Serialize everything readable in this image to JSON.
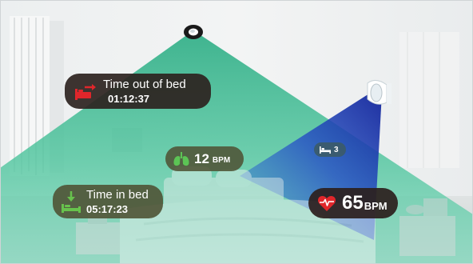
{
  "time_out_of_bed": {
    "label": "Time out of bed",
    "value": "01:12:37"
  },
  "time_in_bed": {
    "label": "Time in bed",
    "value": "05:17:23"
  },
  "respiration": {
    "value": "12",
    "unit": "BPM"
  },
  "heart_rate": {
    "value": "65",
    "unit": "BPM"
  },
  "bed_occupancy": {
    "value": "3"
  },
  "colors": {
    "green_beam": "#3dbf93",
    "blue_beam": "#1f3fb8",
    "pill_dark": "#2c2320",
    "pill_olive": "#4f5335",
    "pill_slate": "#3c5a63",
    "alert_red": "#e0262b",
    "lung_green": "#5cc455",
    "bed_green": "#67c24d"
  },
  "icons": {
    "time_out_of_bed": "bed-exit-icon",
    "time_in_bed": "bed-enter-icon",
    "respiration": "lungs-icon",
    "heart_rate": "heart-pulse-icon",
    "bed_occupancy": "bed-icon"
  }
}
